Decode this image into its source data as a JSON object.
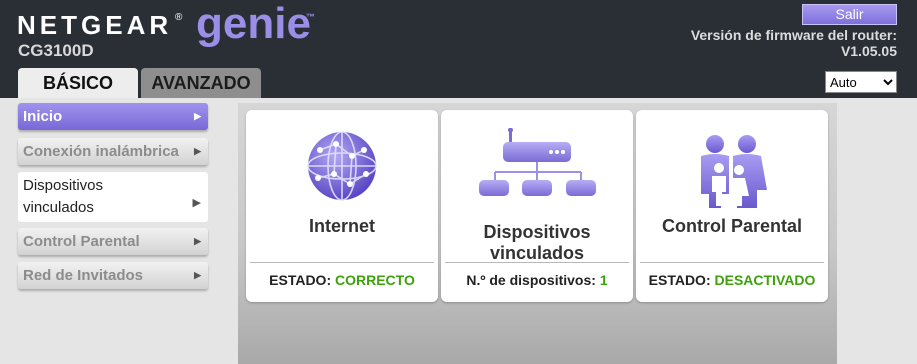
{
  "header": {
    "brand": "NETGEAR",
    "brand_reg": "®",
    "product": "genie",
    "product_tm": "™",
    "model": "CG3100D",
    "logout_label": "Salir",
    "firmware_label": "Versión de firmware del router:",
    "firmware_version": "V1.05.05",
    "language_selected": "Auto"
  },
  "tabs": [
    {
      "label": "BÁSICO",
      "active": true
    },
    {
      "label": "AVANZADO",
      "active": false
    }
  ],
  "sidebar": {
    "items": [
      {
        "label": "Inicio",
        "state": "active"
      },
      {
        "label": "Conexión inalámbrica",
        "state": "normal"
      },
      {
        "label_line1": "Dispositivos",
        "label_line2": "vinculados",
        "state": "normal"
      },
      {
        "label": "Control Parental",
        "state": "normal"
      },
      {
        "label": "Red de Invitados",
        "state": "normal"
      }
    ],
    "arrow": "▶"
  },
  "cards": [
    {
      "icon": "globe-icon",
      "title": "Internet",
      "status_label": "ESTADO:",
      "status_value": "CORRECTO"
    },
    {
      "icon": "network-router-icon",
      "title_line1": "Dispositivos",
      "title_line2": "vinculados",
      "status_label": "N.º de dispositivos:",
      "status_value": "1"
    },
    {
      "icon": "family-icon",
      "title": "Control Parental",
      "status_label": "ESTADO:",
      "status_value": "DESACTIVADO"
    }
  ],
  "colors": {
    "header_bg": "#2a2f36",
    "accent": "#8a7ce0",
    "status_ok": "#3ea10c"
  }
}
